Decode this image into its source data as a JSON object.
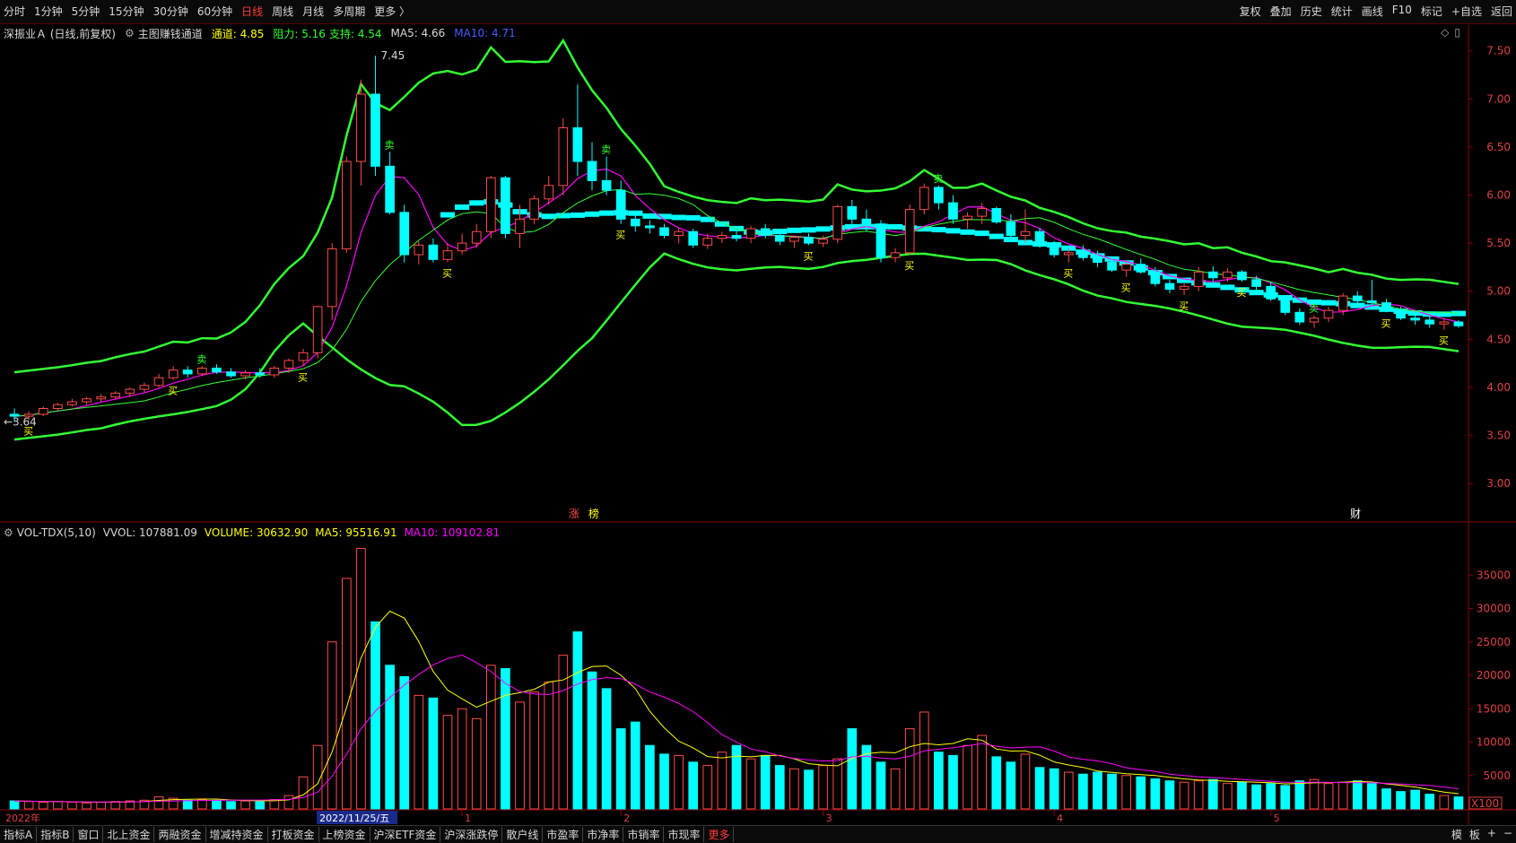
{
  "topbar": {
    "periods": [
      "分时",
      "1分钟",
      "5分钟",
      "15分钟",
      "30分钟",
      "60分钟",
      "日线",
      "周线",
      "月线",
      "多周期",
      "更多 〉"
    ],
    "active_period": "日线",
    "tools": [
      "复权",
      "叠加",
      "历史",
      "统计",
      "画线",
      "F10",
      "标记",
      "+自选",
      "返回"
    ]
  },
  "infobar": {
    "stock": "深振业Ａ (日线,前复权)",
    "indicator": "主图赚钱通道",
    "channel": "通道: 4.85",
    "resistance": "阻力: 5.16",
    "support": "支持: 4.54",
    "ma5": "MA5: 4.66",
    "ma10": "MA10: 4.71"
  },
  "annotations": {
    "high": "7.45",
    "low": "3.64",
    "tags": [
      "涨",
      "榜"
    ],
    "cai": "财",
    "buy_label": "买",
    "sell_label": "卖"
  },
  "volbar": {
    "name": "VOL-TDX(5,10)",
    "vvol": "VVOL: 107881.09",
    "volume": "VOLUME: 30632.90",
    "ma5": "MA5: 95516.91",
    "ma10": "MA10: 109102.81"
  },
  "price_axis": [
    "7.50",
    "7.00",
    "6.50",
    "6.00",
    "5.50",
    "5.00",
    "4.50",
    "4.00",
    "3.50",
    "3.00"
  ],
  "vol_axis": [
    "35000",
    "30000",
    "25000",
    "20000",
    "15000",
    "10000",
    "5000"
  ],
  "vol_unit": "X100",
  "time_axis": {
    "start": "2022年",
    "cursor": "2022/11/25/五",
    "months": [
      "1",
      "2",
      "3",
      "4",
      "5"
    ]
  },
  "bottombar": {
    "tabs": [
      "指标A",
      "指标B",
      "窗口",
      "北上资金",
      "两融资金",
      "增减持资金",
      "打板资金",
      "上榜资金",
      "沪深ETF资金",
      "沪深涨跌停",
      "散户线",
      "市盈率",
      "市净率",
      "市销率",
      "市现率"
    ],
    "more": "更多",
    "right": [
      "模",
      "板",
      "+",
      "−"
    ]
  },
  "sidebar": {
    "label": "日线"
  },
  "colors": {
    "up": "#ff4b4b",
    "down": "#00ffff",
    "ma5": "#ffff00",
    "ma10": "#ff00ff",
    "channel": "#33ff33",
    "grid_red": "#8b0000"
  },
  "chart_data": {
    "type": "candlestick",
    "y_range": [
      2.6,
      7.6
    ],
    "ohlc": [
      [
        3.72,
        3.78,
        3.64,
        3.7
      ],
      [
        3.7,
        3.75,
        3.66,
        3.72
      ],
      [
        3.72,
        3.8,
        3.7,
        3.78
      ],
      [
        3.78,
        3.84,
        3.76,
        3.82
      ],
      [
        3.82,
        3.88,
        3.8,
        3.85
      ],
      [
        3.85,
        3.9,
        3.82,
        3.88
      ],
      [
        3.88,
        3.93,
        3.85,
        3.9
      ],
      [
        3.9,
        3.96,
        3.88,
        3.94
      ],
      [
        3.94,
        4.0,
        3.9,
        3.98
      ],
      [
        3.98,
        4.05,
        3.95,
        4.02
      ],
      [
        4.02,
        4.14,
        4.0,
        4.1
      ],
      [
        4.1,
        4.22,
        4.08,
        4.18
      ],
      [
        4.18,
        4.22,
        4.1,
        4.14
      ],
      [
        4.14,
        4.22,
        4.12,
        4.2
      ],
      [
        4.2,
        4.24,
        4.14,
        4.16
      ],
      [
        4.16,
        4.2,
        4.1,
        4.12
      ],
      [
        4.12,
        4.18,
        4.08,
        4.15
      ],
      [
        4.15,
        4.2,
        4.1,
        4.13
      ],
      [
        4.13,
        4.22,
        4.1,
        4.2
      ],
      [
        4.2,
        4.3,
        4.15,
        4.28
      ],
      [
        4.28,
        4.4,
        4.22,
        4.36
      ],
      [
        4.36,
        4.85,
        4.3,
        4.84
      ],
      [
        4.84,
        5.5,
        4.7,
        5.44
      ],
      [
        5.44,
        6.4,
        5.4,
        6.35
      ],
      [
        6.35,
        7.2,
        6.1,
        7.05
      ],
      [
        7.05,
        7.45,
        6.2,
        6.3
      ],
      [
        6.3,
        6.45,
        5.8,
        5.82
      ],
      [
        5.82,
        5.9,
        5.3,
        5.38
      ],
      [
        5.38,
        5.52,
        5.28,
        5.48
      ],
      [
        5.48,
        5.55,
        5.3,
        5.33
      ],
      [
        5.33,
        5.5,
        5.3,
        5.42
      ],
      [
        5.42,
        5.6,
        5.38,
        5.5
      ],
      [
        5.5,
        5.7,
        5.45,
        5.62
      ],
      [
        5.62,
        6.2,
        5.55,
        6.18
      ],
      [
        6.18,
        6.2,
        5.55,
        5.6
      ],
      [
        5.6,
        5.9,
        5.45,
        5.75
      ],
      [
        5.75,
        6.0,
        5.7,
        5.96
      ],
      [
        5.96,
        6.2,
        5.9,
        6.1
      ],
      [
        6.1,
        6.8,
        6.0,
        6.7
      ],
      [
        6.7,
        7.15,
        6.2,
        6.35
      ],
      [
        6.35,
        6.55,
        6.05,
        6.15
      ],
      [
        6.15,
        6.4,
        6.0,
        6.05
      ],
      [
        6.05,
        6.15,
        5.7,
        5.75
      ],
      [
        5.75,
        5.8,
        5.62,
        5.68
      ],
      [
        5.68,
        5.74,
        5.6,
        5.66
      ],
      [
        5.66,
        5.7,
        5.55,
        5.58
      ],
      [
        5.58,
        5.66,
        5.5,
        5.62
      ],
      [
        5.62,
        5.65,
        5.45,
        5.48
      ],
      [
        5.48,
        5.6,
        5.44,
        5.55
      ],
      [
        5.55,
        5.62,
        5.5,
        5.58
      ],
      [
        5.58,
        5.64,
        5.52,
        5.55
      ],
      [
        5.55,
        5.68,
        5.5,
        5.65
      ],
      [
        5.65,
        5.7,
        5.55,
        5.58
      ],
      [
        5.58,
        5.62,
        5.48,
        5.52
      ],
      [
        5.52,
        5.58,
        5.45,
        5.56
      ],
      [
        5.56,
        5.6,
        5.48,
        5.5
      ],
      [
        5.5,
        5.58,
        5.46,
        5.54
      ],
      [
        5.54,
        5.9,
        5.5,
        5.88
      ],
      [
        5.88,
        5.95,
        5.7,
        5.75
      ],
      [
        5.75,
        5.85,
        5.62,
        5.7
      ],
      [
        5.7,
        5.74,
        5.3,
        5.35
      ],
      [
        5.35,
        5.45,
        5.3,
        5.4
      ],
      [
        5.4,
        5.9,
        5.38,
        5.85
      ],
      [
        5.85,
        6.12,
        5.8,
        6.08
      ],
      [
        6.08,
        6.1,
        5.85,
        5.92
      ],
      [
        5.92,
        6.0,
        5.7,
        5.75
      ],
      [
        5.75,
        5.82,
        5.65,
        5.78
      ],
      [
        5.78,
        5.92,
        5.7,
        5.86
      ],
      [
        5.86,
        5.88,
        5.7,
        5.72
      ],
      [
        5.72,
        5.8,
        5.55,
        5.58
      ],
      [
        5.58,
        5.85,
        5.5,
        5.62
      ],
      [
        5.62,
        5.66,
        5.45,
        5.48
      ],
      [
        5.48,
        5.52,
        5.35,
        5.38
      ],
      [
        5.38,
        5.45,
        5.3,
        5.4
      ],
      [
        5.4,
        5.48,
        5.32,
        5.35
      ],
      [
        5.35,
        5.42,
        5.25,
        5.3
      ],
      [
        5.3,
        5.36,
        5.2,
        5.22
      ],
      [
        5.22,
        5.3,
        5.15,
        5.28
      ],
      [
        5.28,
        5.34,
        5.18,
        5.2
      ],
      [
        5.2,
        5.25,
        5.05,
        5.08
      ],
      [
        5.08,
        5.12,
        4.98,
        5.02
      ],
      [
        5.02,
        5.08,
        4.96,
        5.05
      ],
      [
        5.05,
        5.25,
        5.0,
        5.2
      ],
      [
        5.2,
        5.26,
        5.1,
        5.14
      ],
      [
        5.14,
        5.24,
        5.1,
        5.2
      ],
      [
        5.2,
        5.22,
        5.1,
        5.12
      ],
      [
        5.12,
        5.16,
        5.0,
        5.05
      ],
      [
        5.05,
        5.1,
        4.9,
        4.92
      ],
      [
        4.92,
        4.96,
        4.75,
        4.78
      ],
      [
        4.78,
        4.82,
        4.65,
        4.68
      ],
      [
        4.68,
        4.75,
        4.62,
        4.72
      ],
      [
        4.72,
        4.84,
        4.68,
        4.8
      ],
      [
        4.8,
        4.98,
        4.75,
        4.95
      ],
      [
        4.95,
        5.0,
        4.86,
        4.9
      ],
      [
        4.9,
        5.12,
        4.86,
        4.88
      ],
      [
        4.88,
        4.92,
        4.78,
        4.8
      ],
      [
        4.8,
        4.84,
        4.7,
        4.72
      ],
      [
        4.72,
        4.76,
        4.65,
        4.7
      ],
      [
        4.7,
        4.74,
        4.62,
        4.66
      ],
      [
        4.66,
        4.72,
        4.6,
        4.68
      ],
      [
        4.68,
        4.7,
        4.62,
        4.64
      ]
    ],
    "volume": [
      12,
      11,
      10,
      11,
      10,
      9,
      10,
      11,
      12,
      13,
      18,
      16,
      13,
      14,
      13,
      11,
      12,
      11,
      14,
      20,
      48,
      95,
      250,
      345,
      390,
      280,
      215,
      198,
      170,
      166,
      140,
      150,
      135,
      215,
      210,
      160,
      175,
      190,
      230,
      265,
      205,
      180,
      120,
      130,
      95,
      82,
      80,
      70,
      65,
      85,
      95,
      75,
      80,
      65,
      60,
      58,
      65,
      75,
      120,
      95,
      70,
      60,
      120,
      145,
      85,
      80,
      95,
      110,
      78,
      70,
      82,
      62,
      60,
      55,
      52,
      55,
      52,
      50,
      48,
      45,
      42,
      40,
      42,
      44,
      38,
      40,
      36,
      38,
      35,
      42,
      44,
      38,
      40,
      42,
      38,
      30,
      26,
      28,
      22,
      20,
      18
    ],
    "vol_range": [
      0,
      40000
    ]
  }
}
